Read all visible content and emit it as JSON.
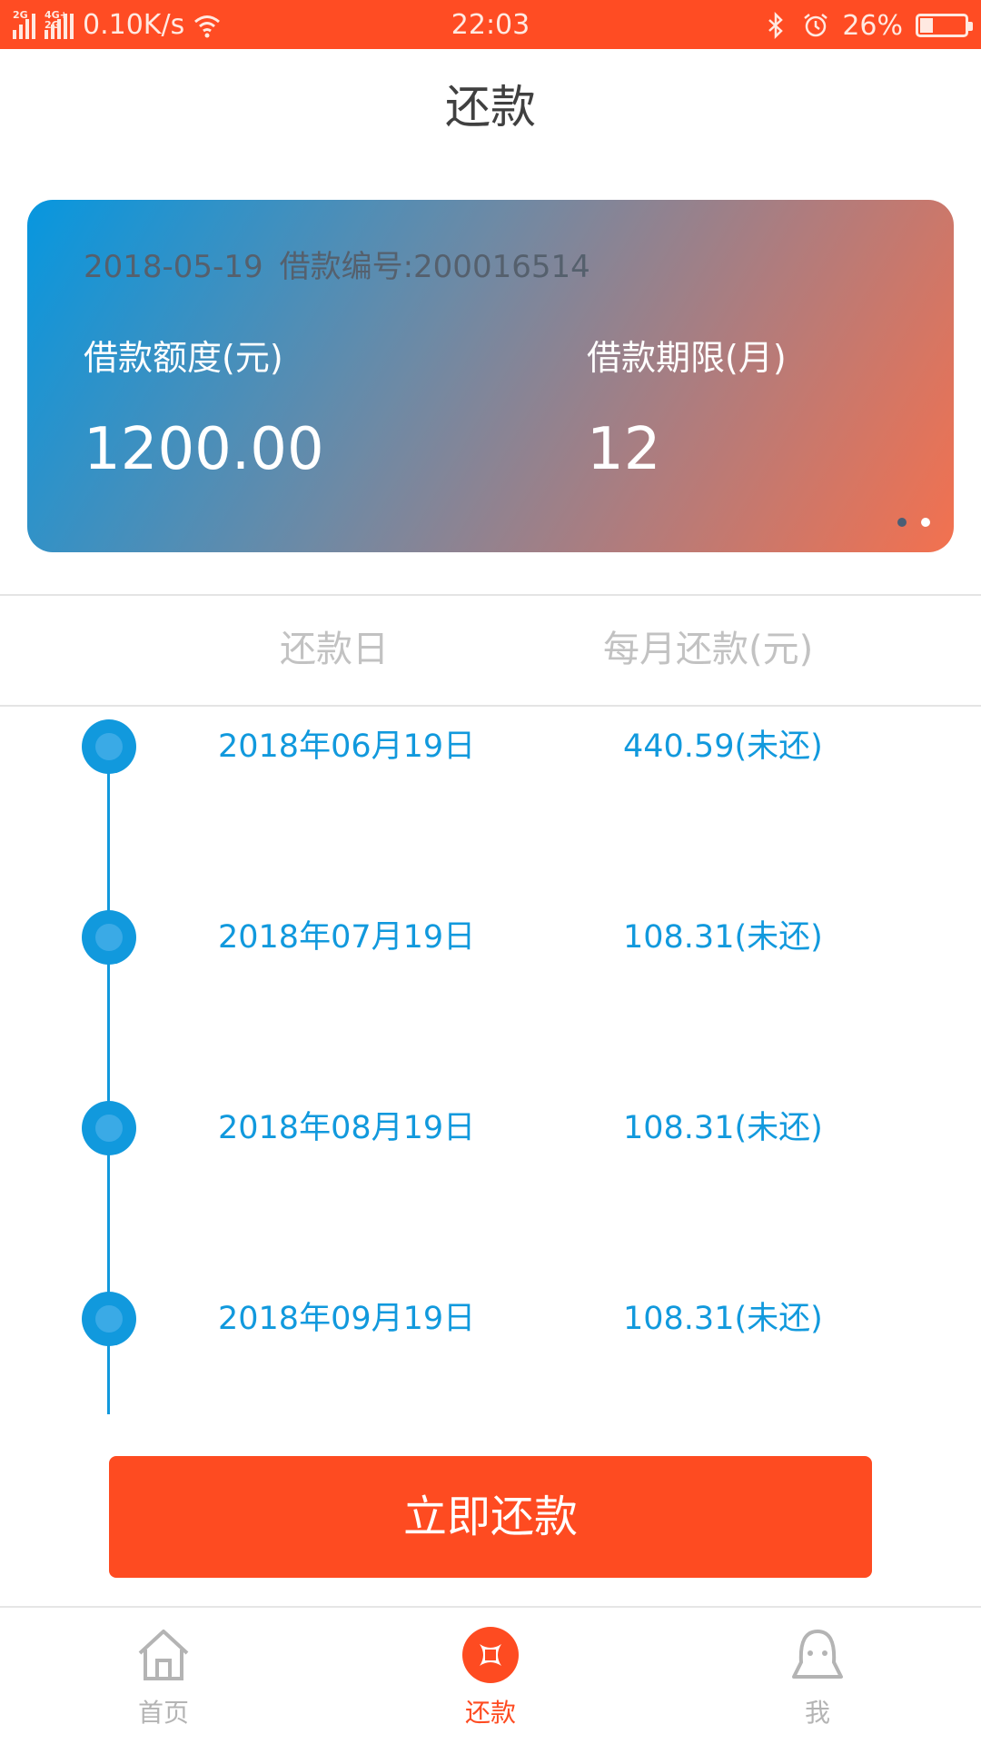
{
  "status_bar": {
    "network_tag_1": "2G",
    "network_tag_2": "4G+ 2G",
    "speed": "0.10K/s",
    "time": "22:03",
    "battery": "26%",
    "battery_level": 0.26,
    "icons": [
      "signal-icon",
      "wifi-icon",
      "bluetooth-icon",
      "alarm-icon",
      "battery-icon"
    ]
  },
  "header": {
    "title": "还款"
  },
  "card": {
    "date": "2018-05-19",
    "loan_no": "借款编号:200016514",
    "amount_label": "借款额度(元)",
    "amount_value": "1200.00",
    "term_label": "借款期限(月)",
    "term_value": "12",
    "page_indicator": {
      "pages": 2,
      "active": 2
    }
  },
  "table": {
    "headers": [
      "还款日",
      "每月还款(元)"
    ],
    "rows": [
      {
        "date": "2018年06月19日",
        "amount": "440.59(未还)"
      },
      {
        "date": "2018年07月19日",
        "amount": "108.31(未还)"
      },
      {
        "date": "2018年08月19日",
        "amount": "108.31(未还)"
      },
      {
        "date": "2018年09月19日",
        "amount": "108.31(未还)"
      }
    ]
  },
  "pay_button": {
    "label": "立即还款"
  },
  "nav": {
    "items": [
      {
        "label": "首页",
        "icon": "home-icon",
        "active": false
      },
      {
        "label": "还款",
        "icon": "repay-icon",
        "active": true
      },
      {
        "label": "我",
        "icon": "user-icon",
        "active": false
      }
    ]
  },
  "colors": {
    "accent": "#fe4b21",
    "timeline_blue": "#1199dd",
    "card_gradient_start": "#0797df",
    "card_gradient_end": "#f3714f",
    "muted_text": "#c2c2c2"
  }
}
